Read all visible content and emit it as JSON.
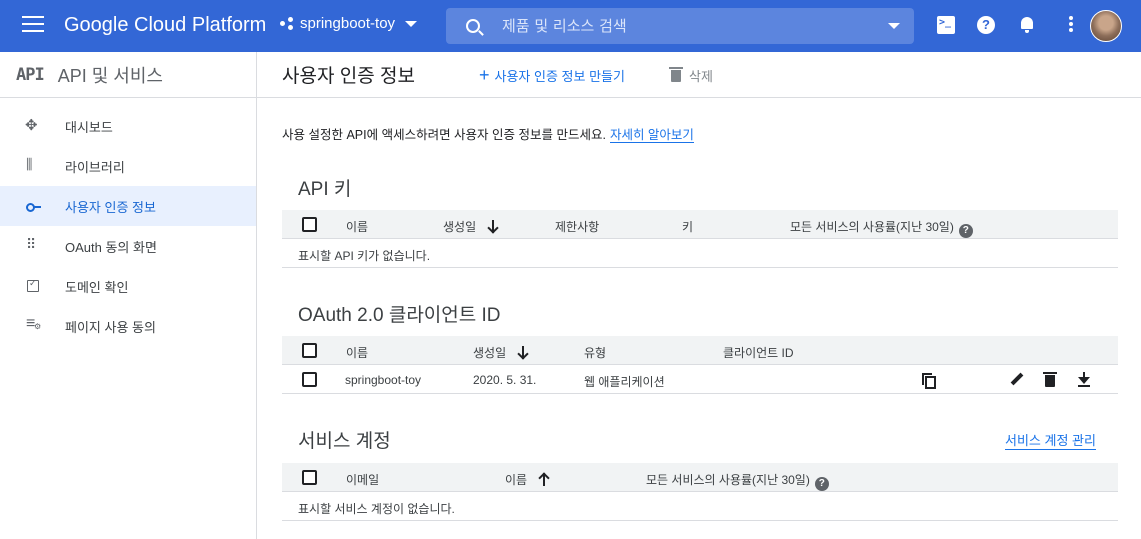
{
  "topbar": {
    "brand": "Google Cloud Platform",
    "project": "springboot-toy",
    "search_placeholder": "제품 및 리소스 검색",
    "colors": {
      "bar": "#3367d6",
      "search": "#5c85de"
    },
    "icons": [
      "menu-icon",
      "project-icon",
      "search-icon",
      "cloud-shell-icon",
      "help-icon",
      "notifications-icon",
      "more-vert-icon",
      "avatar"
    ]
  },
  "sidebar": {
    "logo": "API",
    "title": "API 및 서비스",
    "items": [
      {
        "label": "대시보드",
        "icon": "dashboard-icon"
      },
      {
        "label": "라이브러리",
        "icon": "library-icon"
      },
      {
        "label": "사용자 인증 정보",
        "icon": "key-icon",
        "active": true
      },
      {
        "label": "OAuth 동의 화면",
        "icon": "oauth-icon"
      },
      {
        "label": "도메인 확인",
        "icon": "domain-check-icon"
      },
      {
        "label": "페이지 사용 동의",
        "icon": "page-settings-icon"
      }
    ]
  },
  "main": {
    "title": "사용자 인증 정보",
    "create_label": "사용자 인증 정보 만들기",
    "delete_label": "삭제",
    "intro_text": "사용 설정한 API에 액세스하려면 사용자 인증 정보를 만드세요.",
    "intro_link": "자세히 알아보기",
    "api_keys": {
      "title": "API 키",
      "columns": [
        "이름",
        "생성일",
        "제한사항",
        "키",
        "모든 서비스의 사용률(지난 30일)"
      ],
      "empty": "표시할 API 키가 없습니다."
    },
    "oauth": {
      "title": "OAuth 2.0 클라이언트 ID",
      "columns": [
        "이름",
        "생성일",
        "유형",
        "클라이언트 ID"
      ],
      "rows": [
        {
          "name": "springboot-toy",
          "created": "2020. 5. 31.",
          "type": "웹 애플리케이션",
          "client_id": ""
        }
      ]
    },
    "service_accounts": {
      "title": "서비스 계정",
      "manage_link": "서비스 계정 관리",
      "columns": [
        "이메일",
        "이름",
        "모든 서비스의 사용률(지난 30일)"
      ],
      "empty": "표시할 서비스 계정이 없습니다."
    }
  }
}
